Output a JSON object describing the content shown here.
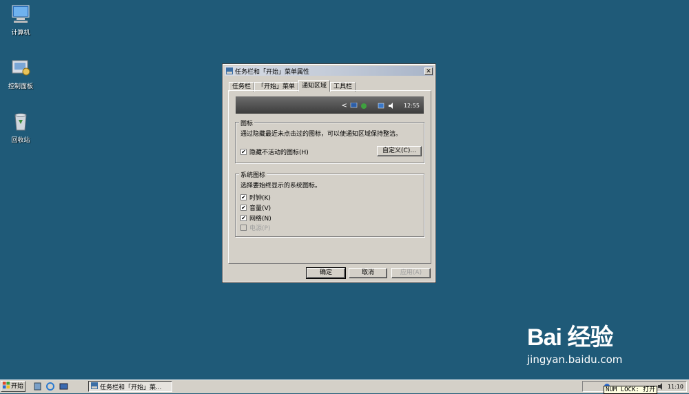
{
  "desktop": {
    "icons": [
      {
        "label": "计算机"
      },
      {
        "label": "控制面板"
      },
      {
        "label": "回收站"
      }
    ]
  },
  "dialog": {
    "title": "任务栏和「开始」菜单属性",
    "close_glyph": "✕",
    "tabs": [
      "任务栏",
      "「开始」菜单",
      "通知区域",
      "工具栏"
    ],
    "active_tab": "通知区域",
    "preview": {
      "arrow": "<",
      "time": "12:55"
    },
    "icons_group": {
      "legend": "图标",
      "description": "通过隐藏最近未点击过的图标，可以使通知区域保持整洁。",
      "hide_inactive": {
        "label": "隐藏不活动的图标(H)",
        "checked": true
      },
      "customize_button": "自定义(C)..."
    },
    "system_icons_group": {
      "legend": "系统图标",
      "description": "选择要始终显示的系统图标。",
      "items": [
        {
          "label": "时钟(K)",
          "checked": true,
          "enabled": true
        },
        {
          "label": "音量(V)",
          "checked": true,
          "enabled": true
        },
        {
          "label": "网络(N)",
          "checked": true,
          "enabled": true
        },
        {
          "label": "电源(P)",
          "checked": false,
          "enabled": false
        }
      ]
    },
    "buttons": {
      "ok": "确定",
      "cancel": "取消",
      "apply": "应用(A)"
    }
  },
  "taskbar": {
    "start_label": "开始",
    "task_button_label": "任务栏和「开始」菜...",
    "clock": "11:10"
  },
  "tooltip": {
    "text": "NUM LOCK: 打开"
  },
  "watermark": {
    "brand": "Bai 经验",
    "url": "jingyan.baidu.com"
  },
  "colors": {
    "desktop": "#1f5a78",
    "dialog_face": "#d4d0c8"
  }
}
